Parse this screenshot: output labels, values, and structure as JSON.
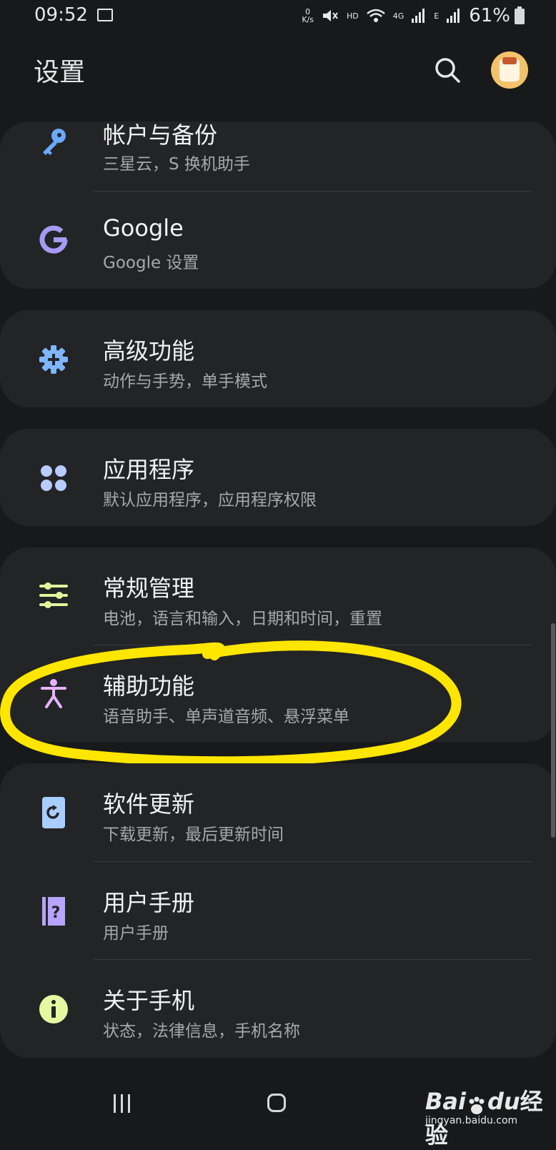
{
  "status_bar": {
    "time": "09:52",
    "net_speed_top": "0",
    "net_speed_unit": "K/s",
    "hd": "HD",
    "net_4g": "4G",
    "net_e": "E",
    "battery_percent": "61%"
  },
  "header": {
    "title": "设置",
    "search_icon": "search-icon",
    "avatar": "avatar"
  },
  "items": [
    {
      "title": "帐户与备份",
      "subtitle": "三星云，S 换机助手",
      "icon": "key-icon",
      "color": "#6aa9ff"
    },
    {
      "title": "Google",
      "subtitle": "Google 设置",
      "icon": "google-g-icon",
      "color": "#a899f5"
    },
    {
      "title": "高级功能",
      "subtitle": "动作与手势，单手模式",
      "icon": "gear-plus-icon",
      "color": "#7fb6ff"
    },
    {
      "title": "应用程序",
      "subtitle": "默认应用程序，应用程序权限",
      "icon": "apps-grid-icon",
      "color": "#b8ccff"
    },
    {
      "title": "常规管理",
      "subtitle": "电池，语言和输入，日期和时间，重置",
      "icon": "sliders-icon",
      "color": "#e3f59c"
    },
    {
      "title": "辅助功能",
      "subtitle": "语音助手、单声道音频、悬浮菜单",
      "icon": "accessibility-icon",
      "color": "#e7b3ff"
    },
    {
      "title": "软件更新",
      "subtitle": "下载更新，最后更新时间",
      "icon": "update-icon",
      "color": "#aacdff"
    },
    {
      "title": "用户手册",
      "subtitle": "用户手册",
      "icon": "manual-icon",
      "color": "#b7a4ff"
    },
    {
      "title": "关于手机",
      "subtitle": "状态，法律信息，手机名称",
      "icon": "info-icon",
      "color": "#e6f7a0"
    }
  ],
  "highlight_color": "#ffe600",
  "nav": {
    "recent": "recent-apps-button",
    "home": "home-button"
  },
  "watermark": {
    "brand": "Bai",
    "brand_mid": "du",
    "brand_suffix": "经验",
    "url": "jingyan.baidu.com"
  }
}
